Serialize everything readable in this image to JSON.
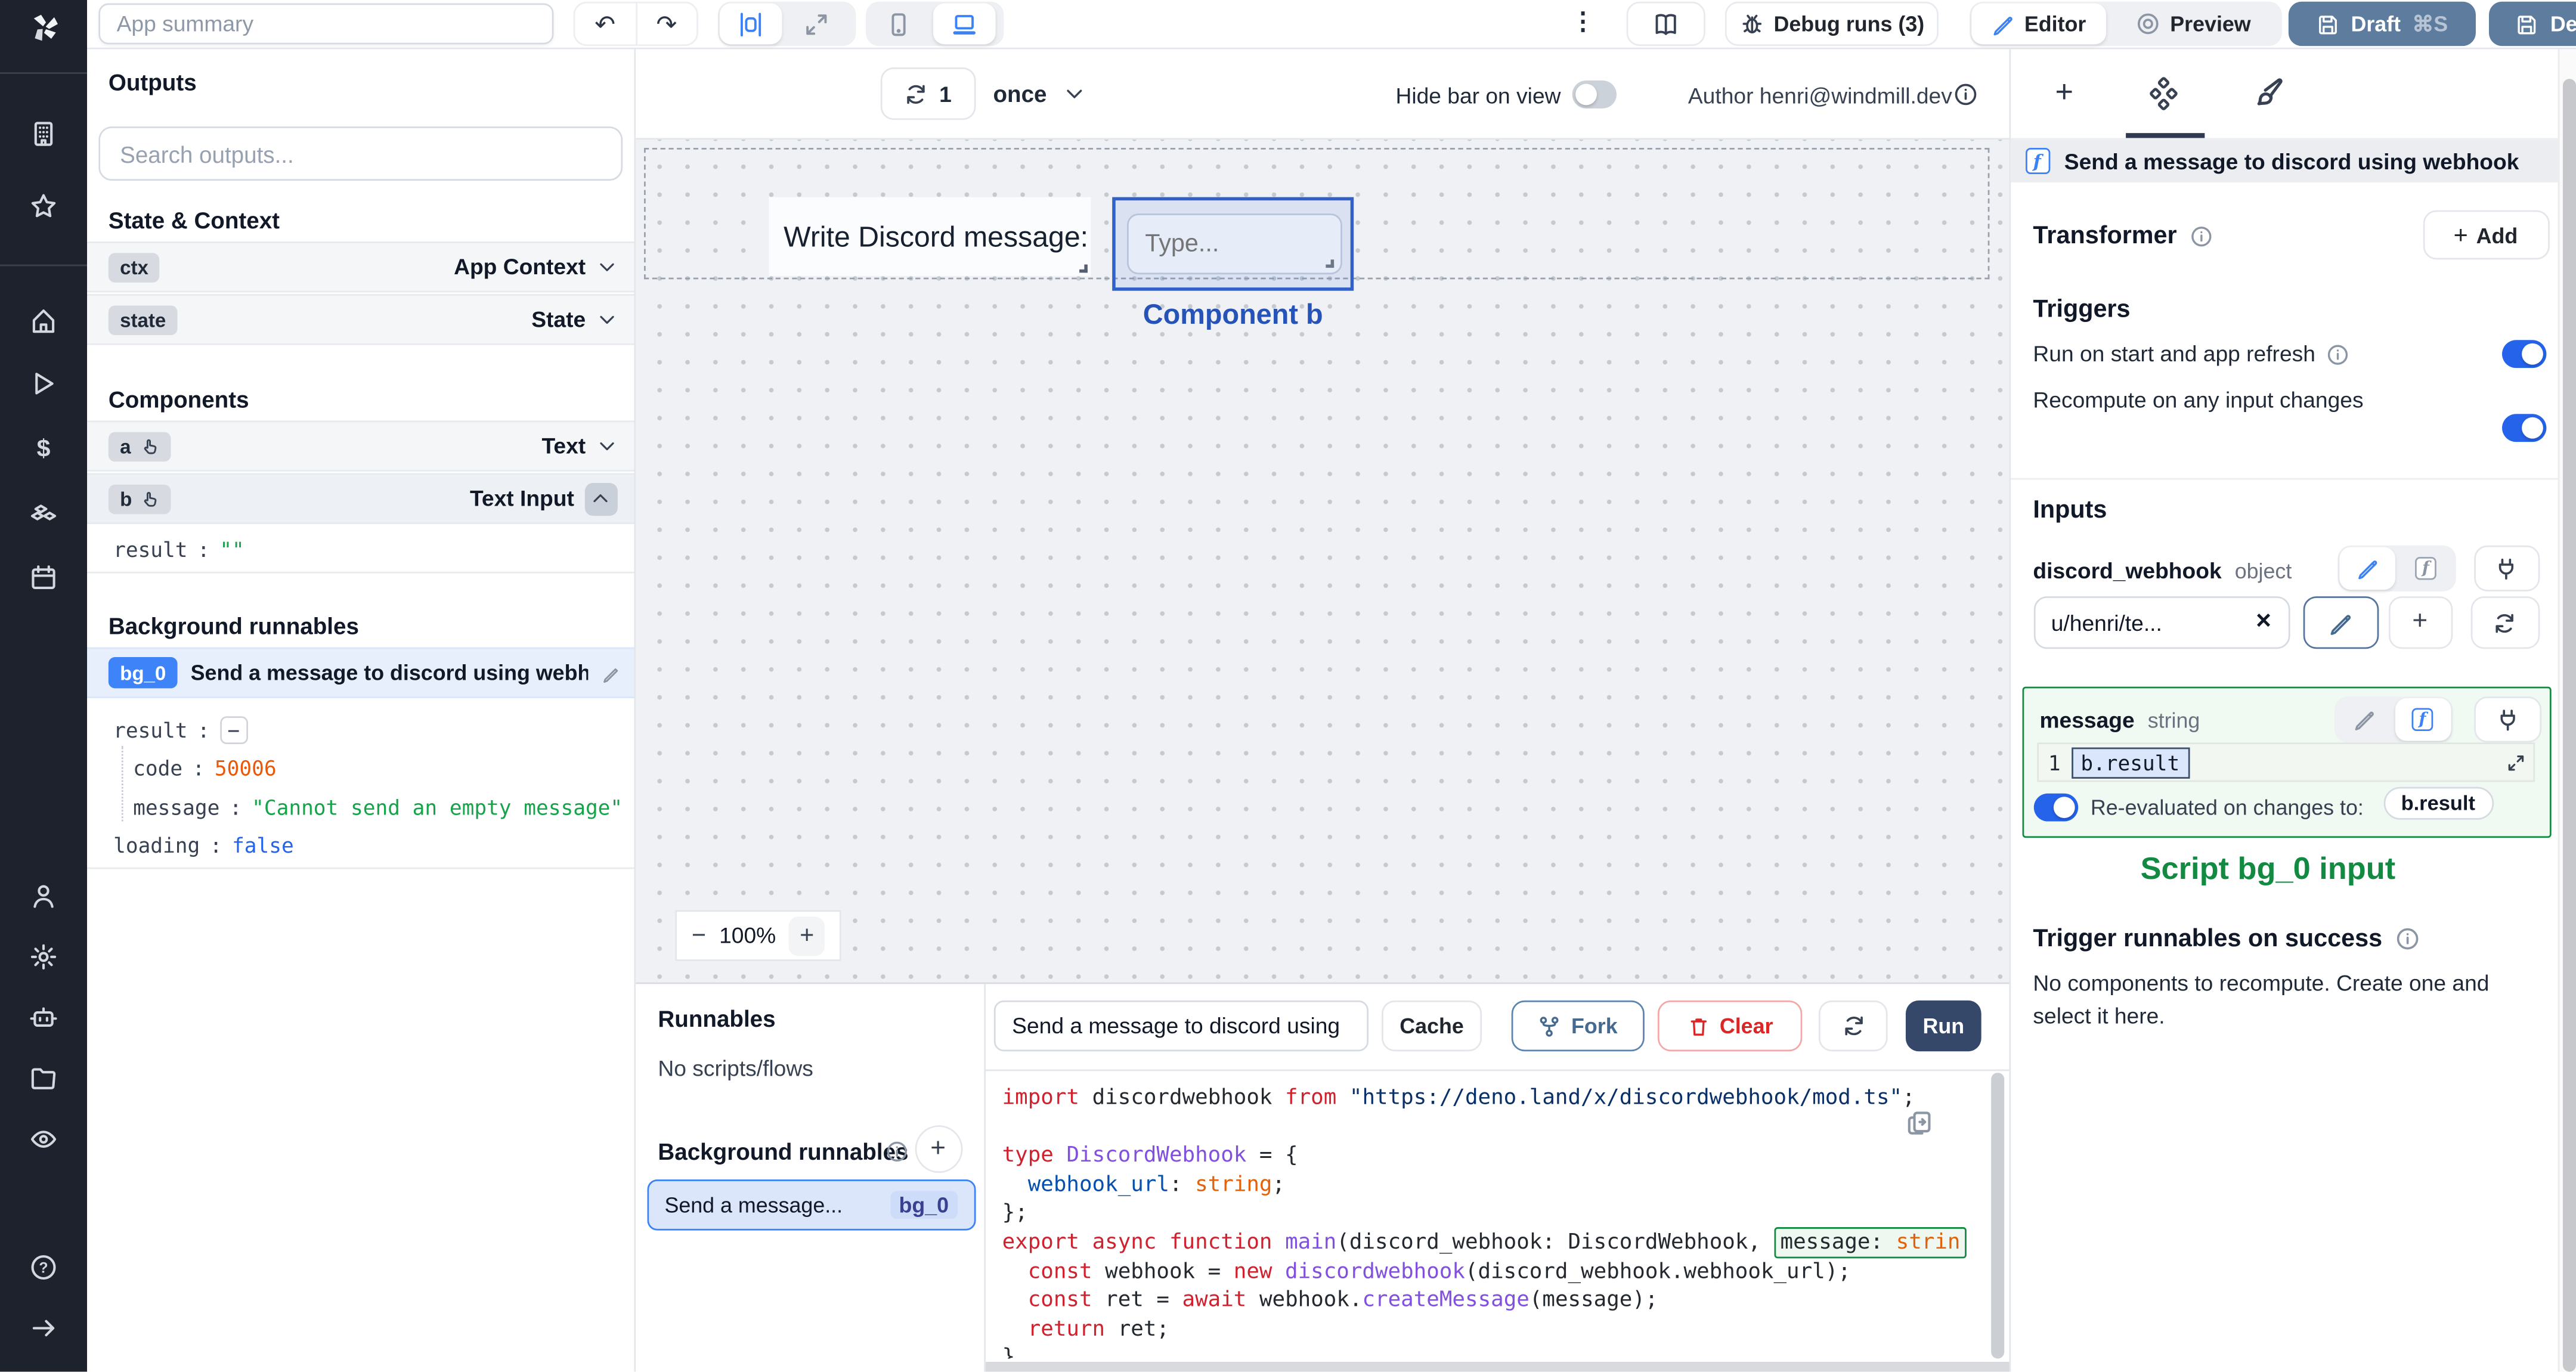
{
  "topbar": {
    "app_summary_placeholder": "App summary",
    "undo_glyph": "↶",
    "redo_glyph": "↷",
    "kebab_glyph": "⋮",
    "debug_runs_label": "Debug runs (3)",
    "editor_label": "Editor",
    "preview_label": "Preview",
    "draft_label": "Draft",
    "draft_shortcut": "⌘S",
    "deploy_label": "Deploy"
  },
  "outputs": {
    "title": "Outputs",
    "search_placeholder": "Search outputs...",
    "state_context_title": "State & Context",
    "ctx": {
      "key": "ctx",
      "type": "App Context"
    },
    "state": {
      "key": "state",
      "type": "State"
    },
    "components_title": "Components",
    "comp_a": {
      "key": "a",
      "type": "Text"
    },
    "comp_b": {
      "key": "b",
      "type": "Text Input",
      "result_key": "result",
      "result_sep": ":",
      "result_value": "\"\""
    },
    "background_title": "Background runnables",
    "bg0": {
      "badge": "bg_0",
      "name": "Send a message to discord using webhook",
      "result_key": "result",
      "result_sep": ":",
      "collapse_glyph": "−",
      "code_key": "code",
      "code_sep": ":",
      "code_value": "50006",
      "message_key": "message",
      "message_sep": ":",
      "message_value": "\"Cannot send an empty message\"",
      "loading_key": "loading",
      "loading_sep": ":",
      "loading_value": "false"
    }
  },
  "canvas": {
    "refresh_count": "1",
    "interval_label": "once",
    "hide_bar_label": "Hide bar on view",
    "author_label": "Author henri@windmill.dev",
    "text_component": "Write Discord message:",
    "input_placeholder": "Type...",
    "selected_component_label": "Component b",
    "zoom_out_glyph": "−",
    "zoom_level": "100%",
    "zoom_in_glyph": "+"
  },
  "runnables": {
    "title": "Runnables",
    "empty_label": "No scripts/flows",
    "background_title": "Background runnables",
    "add_glyph": "+",
    "item": {
      "name": "Send a message...",
      "badge": "bg_0"
    }
  },
  "editor": {
    "name_value": "Send a message to discord using",
    "cache_label": "Cache",
    "fork_label": "Fork",
    "clear_label": "Clear",
    "run_label": "Run"
  },
  "code_editor": {
    "lines": [
      [
        {
          "t": "import",
          "c": "k"
        },
        {
          "t": " discordwebhook ",
          "c": "p"
        },
        {
          "t": "from",
          "c": "k"
        },
        {
          "t": " ",
          "c": "p"
        },
        {
          "t": "\"https://deno.land/x/discordwebhook/mod.ts\"",
          "c": "s"
        },
        {
          "t": ";",
          "c": "p"
        }
      ],
      [],
      [
        {
          "t": "type",
          "c": "k"
        },
        {
          "t": " ",
          "c": "p"
        },
        {
          "t": "DiscordWebhook",
          "c": "t"
        },
        {
          "t": " = {",
          "c": "p"
        }
      ],
      [
        {
          "t": "  ",
          "c": "p"
        },
        {
          "t": "webhook_url",
          "c": "pr"
        },
        {
          "t": ": ",
          "c": "p"
        },
        {
          "t": "string",
          "c": "b"
        },
        {
          "t": ";",
          "c": "p"
        }
      ],
      [
        {
          "t": "};",
          "c": "p"
        }
      ],
      [
        {
          "t": "export",
          "c": "k"
        },
        {
          "t": " ",
          "c": "p"
        },
        {
          "t": "async",
          "c": "k"
        },
        {
          "t": " ",
          "c": "p"
        },
        {
          "t": "function",
          "c": "k"
        },
        {
          "t": " ",
          "c": "p"
        },
        {
          "t": "main",
          "c": "f"
        },
        {
          "t": "(discord_webhook: DiscordWebhook, ",
          "c": "p"
        },
        {
          "t": "message: ",
          "c": "p",
          "hl": true
        },
        {
          "t": "strin",
          "c": "b",
          "hl": true
        }
      ],
      [
        {
          "t": "  ",
          "c": "p"
        },
        {
          "t": "const",
          "c": "k"
        },
        {
          "t": " webhook = ",
          "c": "p"
        },
        {
          "t": "new",
          "c": "k"
        },
        {
          "t": " ",
          "c": "p"
        },
        {
          "t": "discordwebhook",
          "c": "f"
        },
        {
          "t": "(discord_webhook.webhook_url);",
          "c": "p"
        }
      ],
      [
        {
          "t": "  ",
          "c": "p"
        },
        {
          "t": "const",
          "c": "k"
        },
        {
          "t": " ret = ",
          "c": "p"
        },
        {
          "t": "await",
          "c": "k"
        },
        {
          "t": " webhook.",
          "c": "p"
        },
        {
          "t": "createMessage",
          "c": "f"
        },
        {
          "t": "(message);",
          "c": "p"
        }
      ],
      [
        {
          "t": "  ",
          "c": "p"
        },
        {
          "t": "return",
          "c": "k"
        },
        {
          "t": " ret;",
          "c": "p"
        }
      ],
      [
        {
          "t": "}",
          "c": "p"
        }
      ]
    ]
  },
  "right_panel": {
    "header": "Send a message to discord using webhook",
    "transformer_label": "Transformer",
    "add_label": "Add",
    "triggers_title": "Triggers",
    "run_on_start_label": "Run on start and app refresh",
    "recompute_label": "Recompute on any input changes",
    "inputs_title": "Inputs",
    "discord_webhook": {
      "name": "discord_webhook",
      "type": "object",
      "value": "u/henri/te...",
      "clear_glyph": "×"
    },
    "message": {
      "name": "message",
      "type": "string",
      "line_number": "1",
      "value": "b.result"
    },
    "reeval_label": "Re-evaluated on changes to:",
    "reeval_target": "b.result",
    "script_input_label": "Script bg_0 input",
    "trigger_success_title": "Trigger runnables on success",
    "no_components_text": "No components to recompute. Create one and select it here."
  },
  "colors": {
    "accent_blue": "#2563eb",
    "steel_blue": "#5d7c9e",
    "run_navy": "#35486a",
    "badge_blue": "#3f83f8",
    "selection_blue": "#3061c9",
    "component_label_blue": "#2553b8",
    "success_green": "#128a42",
    "json_number": "#e8590c",
    "json_string": "#16a34a",
    "json_bool": "#2563eb"
  }
}
